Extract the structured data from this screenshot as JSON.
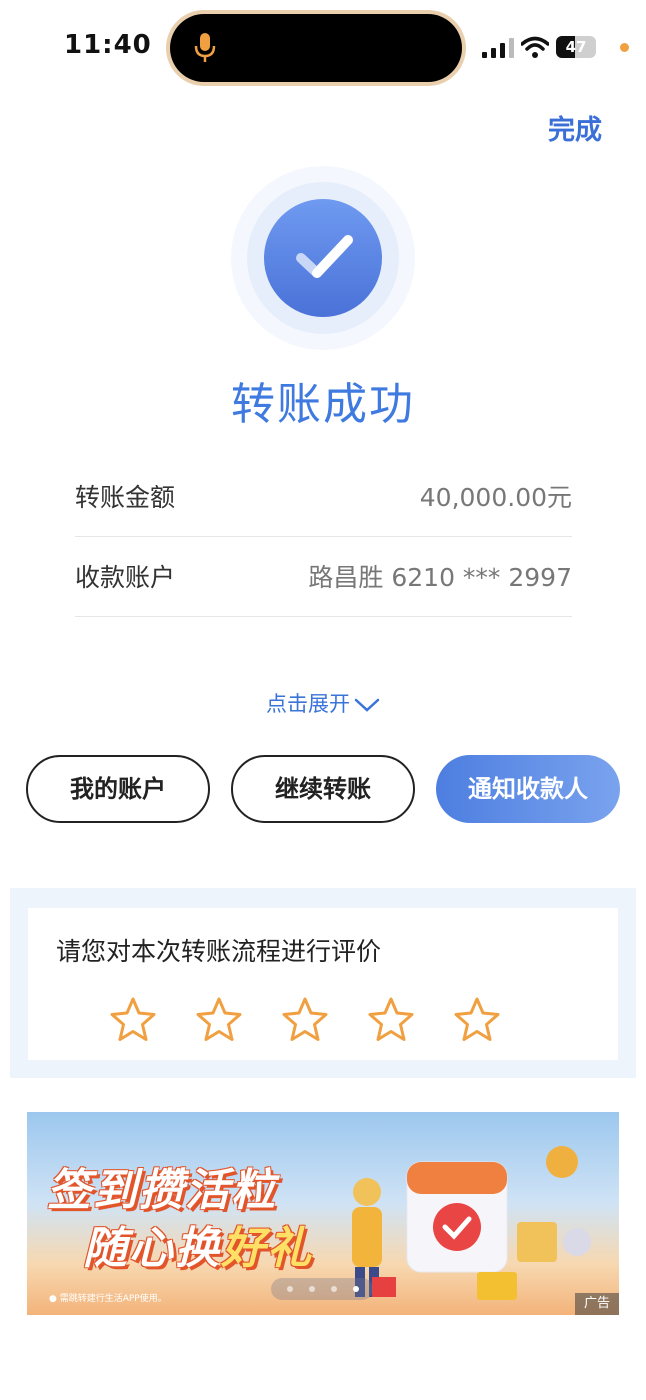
{
  "status_bar": {
    "time": "11:40",
    "battery": "47",
    "battery_level": 0.47
  },
  "header": {
    "done_label": "完成"
  },
  "result": {
    "title": "转账成功"
  },
  "details": [
    {
      "label": "转账金额",
      "value": "40,000.00元"
    },
    {
      "label": "收款账户",
      "value": "路昌胜 6210 *** 2997"
    }
  ],
  "expand_label": "点击展开",
  "actions": {
    "my_account": "我的账户",
    "continue_transfer": "继续转账",
    "notify_payee": "通知收款人"
  },
  "rating": {
    "title": "请您对本次转账流程进行评价",
    "max_stars": 5,
    "star_color": "#f0a040"
  },
  "banner": {
    "line1": "签到攒活粒",
    "line2_a": "随心换",
    "line2_b": "好礼",
    "fine_print": "● 需跳转建行生活APP使用。",
    "ad_label": "广告",
    "slide_count": 4,
    "active_slide": 4
  },
  "colors": {
    "accent": "#3f7ae0",
    "primary_button": "#5a88e4"
  }
}
